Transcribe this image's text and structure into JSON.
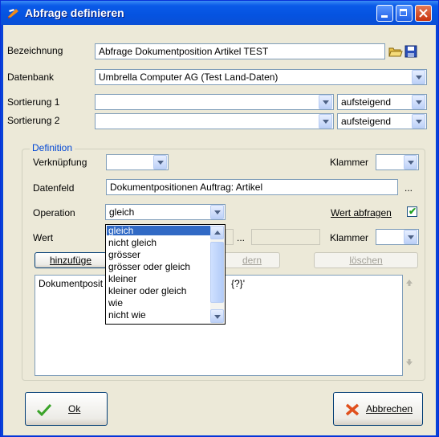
{
  "window": {
    "title": "Abfrage definieren"
  },
  "form": {
    "bezeichnung_label": "Bezeichnung",
    "bezeichnung_value": "Abfrage Dokumentposition Artikel TEST",
    "datenbank_label": "Datenbank",
    "datenbank_value": "Umbrella Computer AG (Test Land-Daten)",
    "sort1_label": "Sortierung 1",
    "sort1_value": "",
    "sort1_order": "aufsteigend",
    "sort2_label": "Sortierung 2",
    "sort2_value": "",
    "sort2_order": "aufsteigend"
  },
  "definition": {
    "group_title": "Definition",
    "verknuepfung_label": "Verknüpfung",
    "verknuepfung_value": "",
    "klammer_label": "Klammer",
    "klammer1_value": "",
    "datenfeld_label": "Datenfeld",
    "datenfeld_value": "Dokumentpositionen Auftrag: Artikel",
    "datenfeld_more": "...",
    "operation_label": "Operation",
    "operation_value": "gleich",
    "wert_abfragen_label": "Wert abfragen",
    "wert_abfragen_checked": true,
    "wert_label": "Wert",
    "wert_more": "...",
    "klammer2_label": "Klammer",
    "klammer2_value": "",
    "hinzufuegen_label": "hinzufüge",
    "aendern_label": "dern",
    "loeschen_label": "löschen",
    "memo_left": "Dokumentposit",
    "memo_right": "{?}'",
    "operation_options": [
      "gleich",
      "nicht gleich",
      "grösser",
      "grösser oder gleich",
      "kleiner",
      "kleiner oder gleich",
      "wie",
      "nicht wie"
    ],
    "operation_selected_index": 0
  },
  "buttons": {
    "ok_label": "Ok",
    "cancel_label": "Abbrechen"
  },
  "colors": {
    "titlebar": "#0553e0",
    "selection": "#316ac5",
    "face": "#ece9d8",
    "group_title": "#0046d5"
  }
}
